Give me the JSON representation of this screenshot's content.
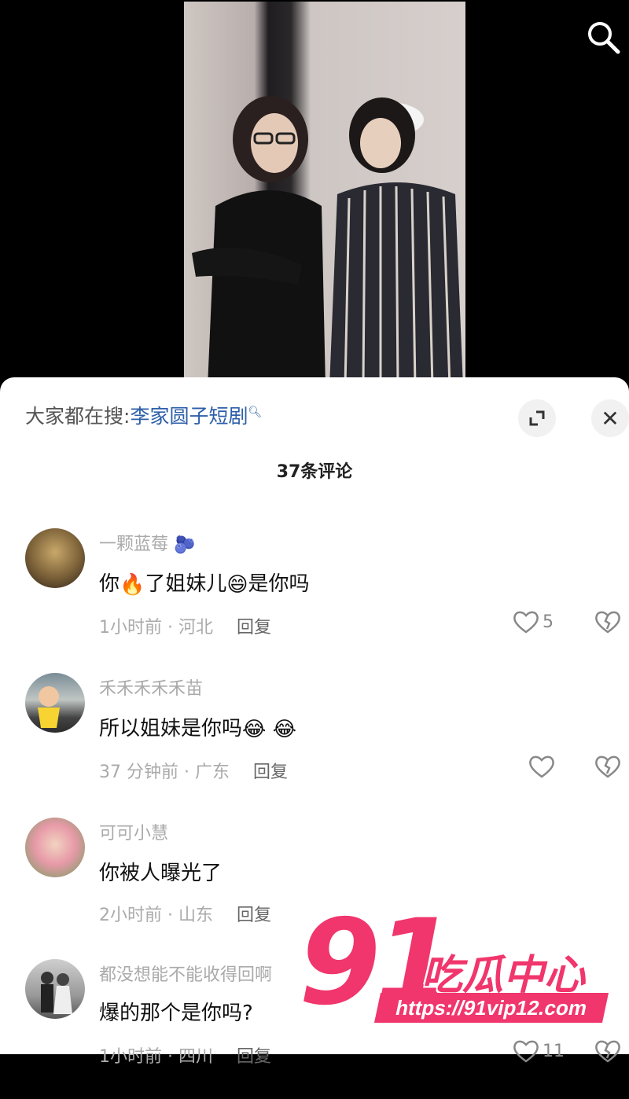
{
  "video": {
    "search_icon": "search-icon"
  },
  "sheet": {
    "trend_prefix": "大家都在搜:",
    "trend_query": "李家圆子短剧",
    "expand_icon": "expand-icon",
    "close_label": "✕",
    "comment_count": "37条评论"
  },
  "comments": [
    {
      "username": "一颗蓝莓",
      "text_parts": [
        "你",
        "了姐妹儿",
        "是你吗"
      ],
      "time": "1小时前 · 河北",
      "reply_label": "回复",
      "likes": "5"
    },
    {
      "username": "禾禾禾禾禾苗",
      "text": "所以姐妹是你吗",
      "time": "37 分钟前 · 广东",
      "reply_label": "回复",
      "likes": ""
    },
    {
      "username": "可可小慧",
      "text": "你被人曝光了",
      "time": "2小时前 · 山东",
      "reply_label": "回复",
      "likes": ""
    },
    {
      "username": "都没想能不能收得回啊",
      "text": "爆的那个是你吗?",
      "time": "1小时前 · 四川",
      "reply_label": "回复",
      "likes": "11"
    }
  ],
  "watermark": {
    "number": "91",
    "brand": "吃瓜中心",
    "url": "https://91vip12.com"
  },
  "colors": {
    "accent_link": "#2d5fa8",
    "watermark": "#f0366c"
  }
}
